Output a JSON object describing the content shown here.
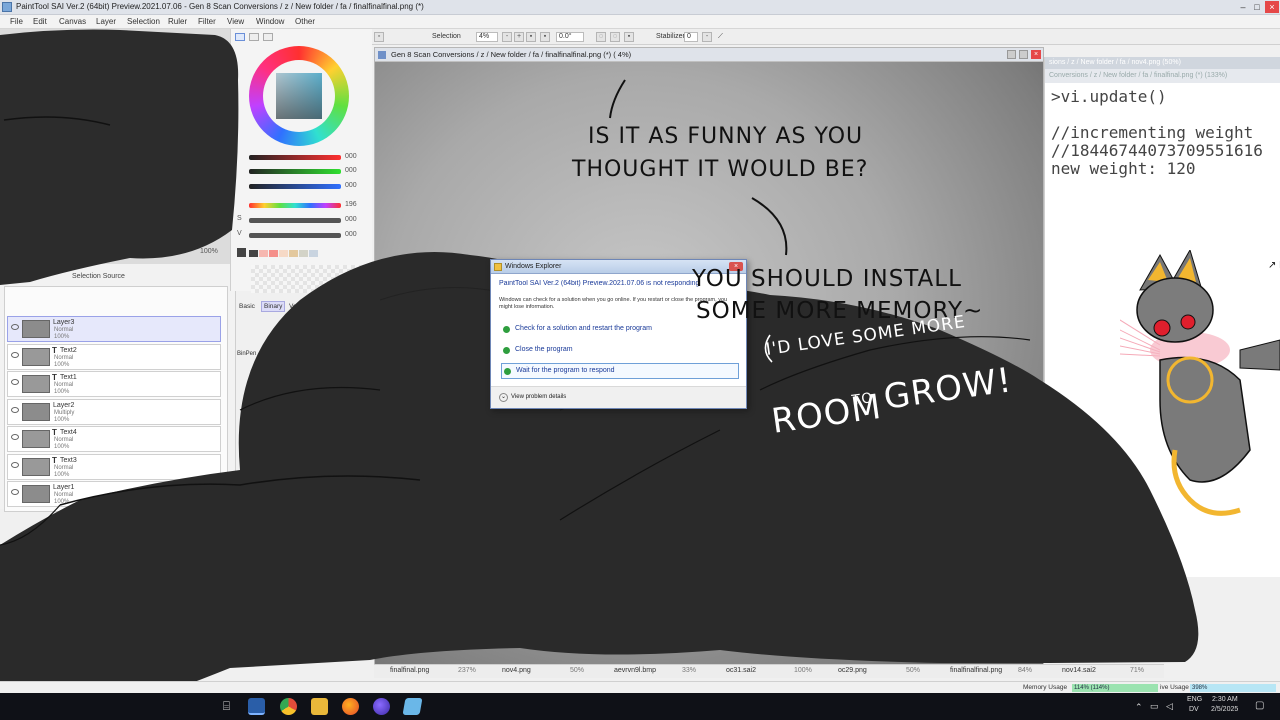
{
  "window": {
    "title": "PaintTool SAI Ver.2 (64bit) Preview.2021.07.06 - Gen 8 Scan Conversions / z / New folder / fa / finalfinalfinal.png (*)"
  },
  "menu": [
    "File",
    "Edit",
    "Canvas",
    "Layer",
    "Selection",
    "Ruler",
    "Filter",
    "View",
    "Window",
    "Other"
  ],
  "toolbar": {
    "selection_label": "Selection",
    "zoom": "4%",
    "rotation": "0.0°",
    "stabilizer_label": "Stabilizer",
    "stabilizer_value": "0"
  },
  "color_panel": {
    "rgb_values": [
      "000",
      "000",
      "000"
    ],
    "h_value": "196",
    "s_value": "000",
    "v_value": "000",
    "s_label": "S",
    "v_label": "V",
    "nav_zoom": "100%",
    "selection_source": "Selection Source",
    "tabs": [
      "Basic",
      "Binary",
      "Ver.1",
      "Artistic"
    ],
    "brush_label": "BinPen",
    "swatch_colors": [
      "#444444",
      "#f6b7b0",
      "#f58f8a",
      "#f6d9c6",
      "#e3c89d",
      "#d3d3c7",
      "#c9d4e0"
    ]
  },
  "layers": [
    {
      "name": "Layer3",
      "type": "layer",
      "mode": "Normal",
      "opacity": "100%",
      "selected": true
    },
    {
      "name": "Text2",
      "type": "text",
      "mode": "Normal",
      "opacity": "100%",
      "selected": false
    },
    {
      "name": "Text1",
      "type": "text",
      "mode": "Normal",
      "opacity": "100%",
      "selected": false
    },
    {
      "name": "Layer2",
      "type": "layer",
      "mode": "Multiply",
      "opacity": "100%",
      "selected": false
    },
    {
      "name": "Text4",
      "type": "text",
      "mode": "Normal",
      "opacity": "100%",
      "selected": false
    },
    {
      "name": "Text3",
      "type": "text",
      "mode": "Normal",
      "opacity": "100%",
      "selected": false
    },
    {
      "name": "Layer1",
      "type": "layer",
      "mode": "Normal",
      "opacity": "100%",
      "selected": false
    }
  ],
  "canvas": {
    "title": "Gen 8 Scan Conversions / z / New folder / fa / finalfinalfinal.png (*) ( 4%)"
  },
  "comic": {
    "bubble1_line1": "IS IT AS FUNNY AS YOU",
    "bubble1_line2": "THOUGHT IT WOULD BE?",
    "bubble2_line1": "YOU SHOULD INSTALL",
    "bubble2_line2": "SOME MORE MEMORY~",
    "bubble3_line1": "I'D LOVE SOME MORE",
    "bubble3_room": "ROOM",
    "bubble3_to": "TO",
    "bubble3_grow": "GROW!"
  },
  "right_window": {
    "bar_text": "Conversions / z / New folder / fa / finalfinal.png (*) (133%)",
    "bar_text2": "sions / z / New folder / fa / nov4.png (50%)",
    "code_lines": [
      ">vi.update()",
      "",
      "//incrementing weight",
      "//18446744073709551616",
      "new weight: 120"
    ]
  },
  "dialog": {
    "title": "Windows Explorer",
    "heading": "PaintTool SAI Ver.2 (64bit) Preview.2021.07.06 is not responding",
    "description": "Windows can check for a solution when you go online. If you restart or close the program, you might lose information.",
    "options": [
      "Check for a solution and restart the program",
      "Close the program",
      "Wait for the program to respond"
    ],
    "details": "View problem details"
  },
  "doc_tabs": [
    {
      "name": "finalfinal.png",
      "zoom": "237%"
    },
    {
      "name": "nov4.png",
      "zoom": "50%"
    },
    {
      "name": "aevrvn9l.bmp",
      "zoom": "33%"
    },
    {
      "name": "oc31.sai2",
      "zoom": "100%"
    },
    {
      "name": "oc29.png",
      "zoom": "50%"
    },
    {
      "name": "finalfinalfinal.png",
      "zoom": "84%"
    },
    {
      "name": "nov14.sai2",
      "zoom": "71%"
    }
  ],
  "status": {
    "memory_label": "Memory Usage",
    "memory_value": "114% (114%)",
    "drive_label": "ive Usage",
    "drive_value": "398%"
  },
  "taskbar": {
    "lang1": "ENG",
    "lang2": "DV",
    "time": "2:30 AM",
    "date": "2/5/2025"
  }
}
